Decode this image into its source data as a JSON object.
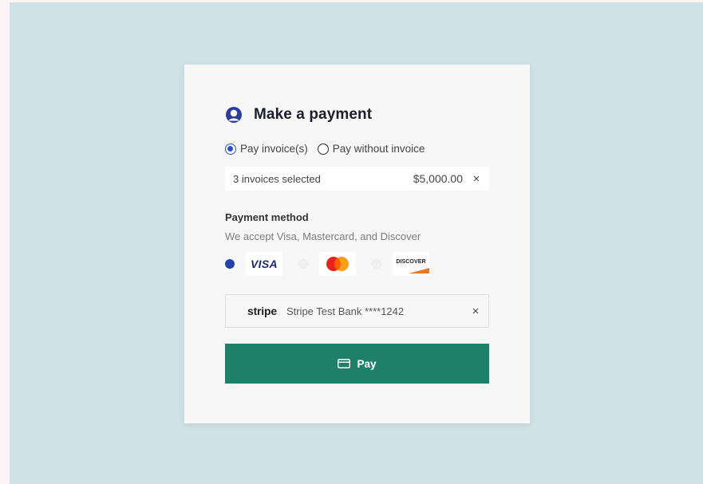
{
  "payment": {
    "title": "Make a payment",
    "icons": {
      "header": "user-avatar-icon",
      "close": "close-icon",
      "pay": "credit-card-icon"
    },
    "colors": {
      "accent": "#2850c8",
      "pay_button": "#1f8069",
      "background": "#cfe2e7"
    },
    "modes": [
      {
        "label": "Pay invoice(s)",
        "selected": true
      },
      {
        "label": "Pay without invoice",
        "selected": false
      }
    ],
    "invoice": {
      "summary": "3 invoices selected",
      "amount": "$5,000.00",
      "remove": "×"
    },
    "method": {
      "label": "Payment method",
      "subtitle": "We accept Visa, Mastercard, and Discover",
      "cards": [
        {
          "name": "visa",
          "text": "VISA",
          "selected": true
        },
        {
          "name": "mastercard",
          "text": "",
          "selected": false
        },
        {
          "name": "discover",
          "text": "DISCOVER",
          "selected": false
        }
      ]
    },
    "bank": {
      "brand": "stripe",
      "account": "Stripe Test Bank ****1242",
      "remove": "×"
    },
    "pay_label": "Pay"
  }
}
